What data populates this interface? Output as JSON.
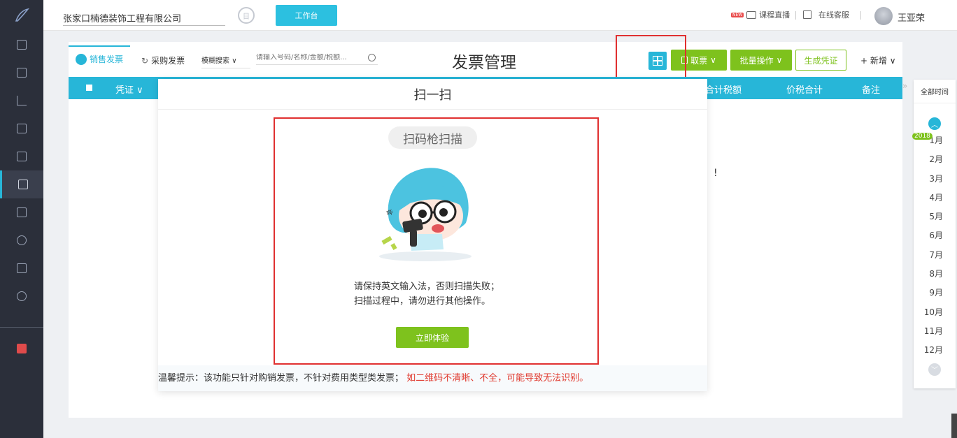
{
  "colors": {
    "accent": "#27b6d8",
    "green": "#7ec21d",
    "highlight_red": "#e03030",
    "sidebar": "#2b2f3a"
  },
  "topbar": {
    "company": "张家口楠德装饰工程有限公司",
    "workbench": "工作台",
    "live_badge": "NEW",
    "live": "课程直播",
    "service": "在线客服",
    "user": "王亚荣"
  },
  "sidebar": {
    "items": [
      {
        "icon": "list-icon"
      },
      {
        "icon": "ledger-icon"
      },
      {
        "icon": "chart-icon"
      },
      {
        "icon": "building-icon"
      },
      {
        "icon": "calendar-icon"
      },
      {
        "icon": "invoice-icon",
        "active": true
      },
      {
        "icon": "image-icon"
      },
      {
        "icon": "coins-icon"
      },
      {
        "icon": "report-icon"
      },
      {
        "icon": "settings-icon"
      }
    ]
  },
  "toolbar": {
    "tab_sales": "销售发票",
    "tab_purchase": "采购发票",
    "fuzzy": "模糊搜索",
    "search_placeholder": "请输入号码/名称/金额/税额...",
    "page_title": "发票管理",
    "fetch": "取票",
    "batch": "批量操作",
    "gen_voucher": "生成凭证",
    "add_new": "+ 新增"
  },
  "table": {
    "col_voucher": "凭证",
    "col_total_tax": "合计税额",
    "col_price_total": "价税合计",
    "col_remark": "备注",
    "exclaim": "!"
  },
  "modal": {
    "title": "扫一扫",
    "scan_gun": "扫码枪扫描",
    "mascot_sound": "哔",
    "tip_line1": "请保持英文输入法，否则扫描失败；",
    "tip_line2": "扫描过程中，请勿进行其他操作。",
    "try_now": "立即体验",
    "notice_prefix": "温馨提示：该功能只针对购销发票，不针对费用类型类发票；",
    "notice_warn": "如二维码不清晰、不全，可能导致无法识别。"
  },
  "months": {
    "all_time": "全部时间",
    "year": "2018",
    "list": [
      "1月",
      "2月",
      "3月",
      "4月",
      "5月",
      "6月",
      "7月",
      "8月",
      "9月",
      "10月",
      "11月",
      "12月"
    ]
  }
}
